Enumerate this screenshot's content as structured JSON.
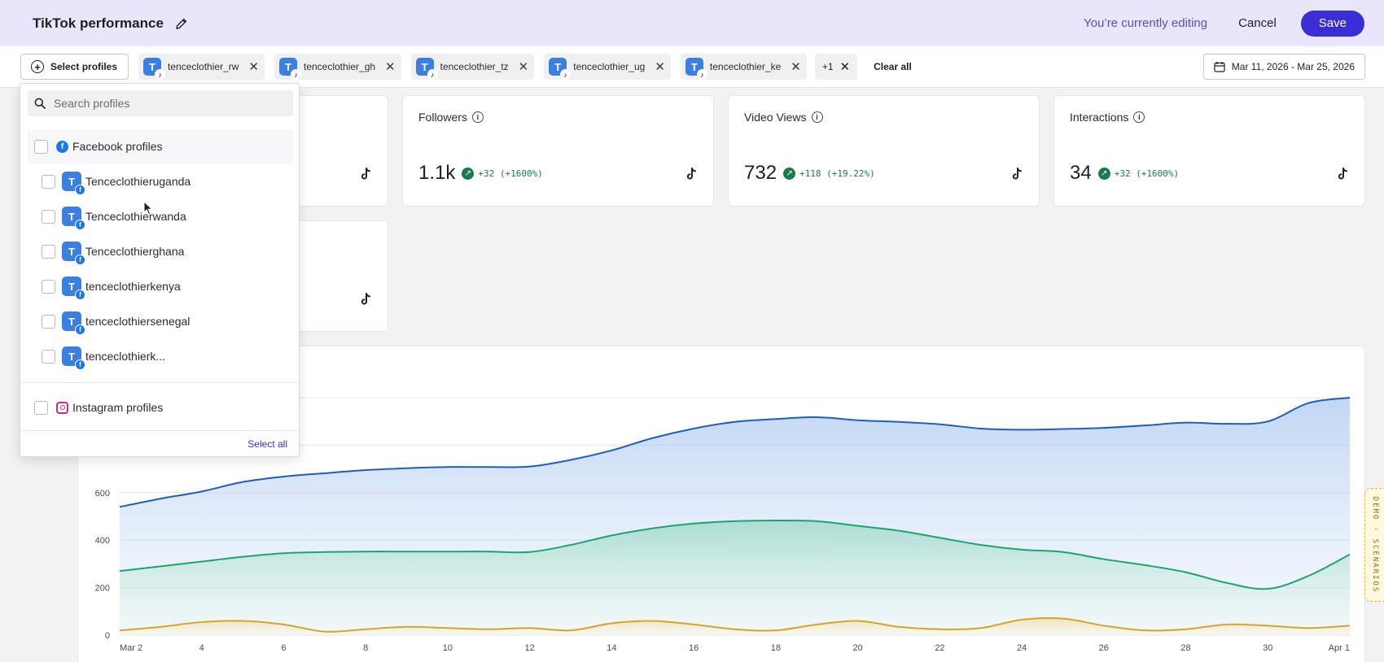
{
  "header": {
    "title": "TikTok performance",
    "editing_text": "You’re currently editing",
    "cancel_label": "Cancel",
    "save_label": "Save"
  },
  "filters": {
    "select_profiles_label": "Select profiles",
    "chips": [
      {
        "initial": "T",
        "label": "tenceclothier_rw"
      },
      {
        "initial": "T",
        "label": "tenceclothier_gh"
      },
      {
        "initial": "T",
        "label": "tenceclothier_tz"
      },
      {
        "initial": "T",
        "label": "tenceclothier_ug"
      },
      {
        "initial": "T",
        "label": "tenceclothier_ke"
      }
    ],
    "more_chip": "+1",
    "clear_all_label": "Clear all",
    "date_range": "Mar 11, 2026 - Mar 25, 2026"
  },
  "metrics": [
    {
      "title": "Followers",
      "value": "1.1k",
      "change": "+32 (+1600%)"
    },
    {
      "title": "Video Views",
      "value": "732",
      "change": "+118 (+19.22%)"
    },
    {
      "title": "Interactions",
      "value": "34",
      "change": "+32 (+1600%)"
    }
  ],
  "dropdown": {
    "search_placeholder": "Search profiles",
    "facebook_group": "Facebook profiles",
    "facebook_profiles": [
      {
        "initial": "T",
        "name": "Tenceclothieruganda"
      },
      {
        "initial": "T",
        "name": "Tenceclothierwanda"
      },
      {
        "initial": "T",
        "name": "Tenceclothierghana"
      },
      {
        "initial": "T",
        "name": "tenceclothierkenya"
      },
      {
        "initial": "T",
        "name": "tenceclothiersenegal"
      },
      {
        "initial": "T",
        "name": "tenceclothierk..."
      }
    ],
    "instagram_group": "Instagram profiles",
    "select_all_label": "Select all"
  },
  "demo_tab": "DEMO · SCENARIOS",
  "colors": {
    "accent": "#3a2fd6",
    "header_bg": "#e9e6fb",
    "positive": "#1b7a4c",
    "series_blue": "#1f5fb8",
    "series_green": "#1aa56e",
    "series_yellow": "#d4a52a"
  },
  "chart_data": {
    "type": "area",
    "x": [
      "Mar 2",
      "3",
      "4",
      "5",
      "6",
      "7",
      "8",
      "9",
      "10",
      "11",
      "12",
      "13",
      "14",
      "15",
      "16",
      "17",
      "18",
      "19",
      "20",
      "21",
      "22",
      "23",
      "24",
      "25",
      "26",
      "27",
      "28",
      "29",
      "30",
      "31",
      "Apr 1"
    ],
    "x_tick_labels": [
      "Mar 2",
      "4",
      "6",
      "8",
      "10",
      "12",
      "14",
      "16",
      "18",
      "20",
      "22",
      "24",
      "26",
      "28",
      "30",
      "Apr 1"
    ],
    "y_tick_labels": [
      "0",
      "200",
      "400",
      "600"
    ],
    "ylim": [
      0,
      1000
    ],
    "grid": true,
    "series": [
      {
        "values": [
          540,
          575,
          605,
          645,
          668,
          682,
          695,
          703,
          708,
          708,
          710,
          738,
          778,
          830,
          870,
          898,
          910,
          918,
          905,
          898,
          888,
          870,
          865,
          868,
          873,
          883,
          895,
          890,
          900,
          978,
          1000
        ]
      },
      {
        "values": [
          270,
          290,
          310,
          330,
          345,
          350,
          352,
          352,
          352,
          352,
          350,
          380,
          420,
          450,
          470,
          480,
          483,
          480,
          460,
          440,
          410,
          380,
          360,
          350,
          320,
          295,
          265,
          220,
          195,
          250,
          340
        ]
      },
      {
        "values": [
          20,
          35,
          55,
          60,
          45,
          15,
          25,
          35,
          30,
          25,
          30,
          20,
          50,
          60,
          45,
          25,
          20,
          45,
          60,
          35,
          25,
          30,
          65,
          70,
          40,
          20,
          25,
          45,
          40,
          30,
          40
        ]
      }
    ]
  }
}
